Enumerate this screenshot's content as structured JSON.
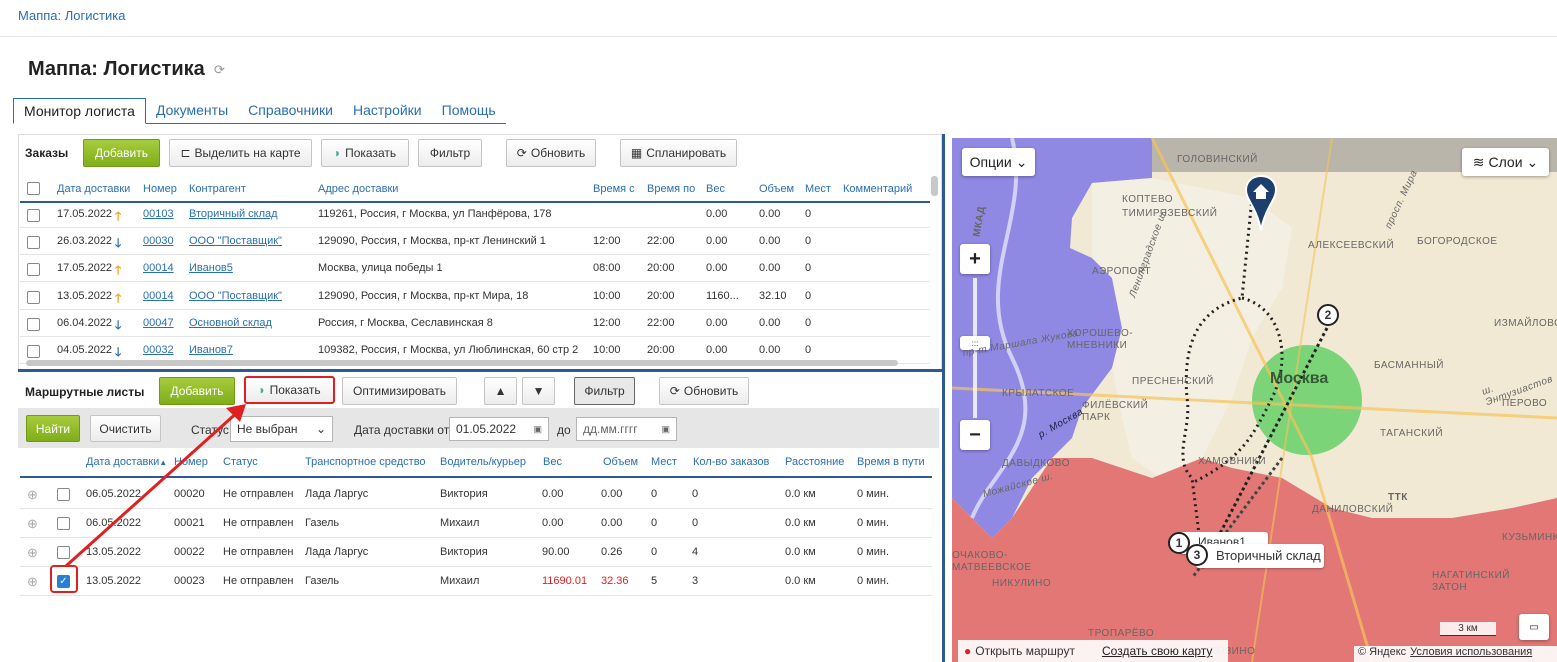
{
  "breadcrumb": "Маппа: Логистика",
  "page_title": "Маппа: Логистика",
  "tabs": [
    "Монитор логиста",
    "Документы",
    "Справочники",
    "Настройки",
    "Помощь"
  ],
  "orders": {
    "label": "Заказы",
    "add": "Добавить",
    "highlight": "Выделить на карте",
    "show": "Показать",
    "filter": "Фильтр",
    "refresh": "Обновить",
    "plan": "Спланировать",
    "headers": [
      "Дата доставки",
      "Номер",
      "Контрагент",
      "Адрес доставки",
      "Время с",
      "Время по",
      "Вес",
      "Объем",
      "Мест",
      "Комментарий"
    ],
    "rows": [
      {
        "date": "17.05.2022",
        "dir": "up",
        "num": "00103",
        "contr": "Вторичный склад",
        "addr": "119261, Россия, г Москва, ул Панфёрова, 178",
        "from": "",
        "to": "",
        "w": "0.00",
        "v": "0.00",
        "p": "0"
      },
      {
        "date": "26.03.2022",
        "dir": "down",
        "num": "00030",
        "contr": "ООО \"Поставщик\"",
        "addr": "129090, Россия, г Москва, пр-кт Ленинский 1",
        "from": "12:00",
        "to": "22:00",
        "w": "0.00",
        "v": "0.00",
        "p": "0"
      },
      {
        "date": "17.05.2022",
        "dir": "up",
        "num": "00014",
        "contr": "Иванов5",
        "addr": "Москва, улица победы 1",
        "from": "08:00",
        "to": "20:00",
        "w": "0.00",
        "v": "0.00",
        "p": "0"
      },
      {
        "date": "13.05.2022",
        "dir": "up",
        "num": "00014",
        "contr": "ООО \"Поставщик\"",
        "addr": "129090, Россия, г Москва, пр-кт Мира, 18",
        "from": "10:00",
        "to": "20:00",
        "w": "1160...",
        "v": "32.10",
        "p": "0"
      },
      {
        "date": "06.04.2022",
        "dir": "down",
        "num": "00047",
        "contr": "Основной склад",
        "addr": "Россия, г Москва, Сеславинская 8",
        "from": "12:00",
        "to": "22:00",
        "w": "0.00",
        "v": "0.00",
        "p": "0"
      },
      {
        "date": "04.05.2022",
        "dir": "down",
        "num": "00032",
        "contr": "Иванов7",
        "addr": "109382, Россия, г Москва, ул Люблинская, 60 стр 2",
        "from": "10:00",
        "to": "20:00",
        "w": "0.00",
        "v": "0.00",
        "p": "0"
      }
    ]
  },
  "routes": {
    "label": "Маршрутные листы",
    "add": "Добавить",
    "show": "Показать",
    "optimize": "Оптимизировать",
    "up": "▲",
    "down": "▼",
    "filter": "Фильтр",
    "refresh": "Обновить",
    "find": "Найти",
    "clear": "Очистить",
    "status_label": "Статус",
    "status_value": "Не выбран",
    "date_from_label": "Дата доставки от",
    "date_from": "01.05.2022",
    "date_to_label": "до",
    "date_to_placeholder": "дд.мм.гггг",
    "headers": [
      "Дата доставки",
      "Номер",
      "Статус",
      "Транспортное средство",
      "Водитель/курьер",
      "Вес",
      "Объем",
      "Мест",
      "Кол-во заказов",
      "Расстояние",
      "Время в пути"
    ],
    "rows": [
      {
        "date": "06.05.2022",
        "num": "00020",
        "status": "Не отправлен",
        "vehicle": "Лада Ларгус",
        "driver": "Виктория",
        "w": "0.00",
        "v": "0.00",
        "p": "0",
        "n": "0",
        "dist": "0.0 км",
        "time": "0 мин.",
        "checked": false,
        "red": false
      },
      {
        "date": "06.05.2022",
        "num": "00021",
        "status": "Не отправлен",
        "vehicle": "Газель",
        "driver": "Михаил",
        "w": "0.00",
        "v": "0.00",
        "p": "0",
        "n": "0",
        "dist": "0.0 км",
        "time": "0 мин.",
        "checked": false,
        "red": false
      },
      {
        "date": "13.05.2022",
        "num": "00022",
        "status": "Не отправлен",
        "vehicle": "Лада Ларгус",
        "driver": "Виктория",
        "w": "90.00",
        "v": "0.26",
        "p": "0",
        "n": "4",
        "dist": "0.0 км",
        "time": "0 мин.",
        "checked": false,
        "red": false
      },
      {
        "date": "13.05.2022",
        "num": "00023",
        "status": "Не отправлен",
        "vehicle": "Газель",
        "driver": "Михаил",
        "w": "11690.01",
        "v": "32.36",
        "p": "5",
        "n": "3",
        "dist": "0.0 км",
        "time": "0 мин.",
        "checked": true,
        "red": true
      }
    ]
  },
  "map": {
    "options": "Опции",
    "layers": "Слои",
    "city": "Москва",
    "zoom_in": "+",
    "zoom_out": "−",
    "labels": [
      "ГОЛОВИНСКИЙ",
      "КОПТЕВО",
      "ТИМИРЯЗЕВСКИЙ",
      "АЭРОПОРТ",
      "АЛЕКСЕЕВСКИЙ",
      "БОГОРОДСКОЕ",
      "ХОРОШЕВО-МНЕВНИКИ",
      "ПРЕСНЕНСКИЙ",
      "КРЫЛАТСКОЕ",
      "ФИЛЁВСКИЙ ПАРК",
      "ДАВЫДКОВО",
      "ХАМОВНИКИ",
      "БАСМАННЫЙ",
      "ТАГАНСКИЙ",
      "ИЗМАЙЛОВО",
      "ПЕРОВО",
      "ДАНИЛОВСКИЙ",
      "НАГАТИНСКИЙ ЗАТОН",
      "ТРОПАРЁВО",
      "НИКУЛИНО",
      "ЗЮЗИНО",
      "ОЧАКОВО-МАТВЕЕВСКОЕ",
      "КУЗЬМИНКИ",
      "ТТК",
      "МКАД"
    ],
    "roads": [
      "Ленинградское ш.",
      "просп. Мира",
      "пр-т Маршала Жукова",
      "р. Москва",
      "Можайское ш.",
      "ш. Энтузиастов"
    ],
    "marker_labels": [
      "Иванов1",
      "Вторичный склад"
    ],
    "marker_nums": [
      "1",
      "2",
      "3"
    ],
    "scale": "3 км",
    "open_route": "Открыть маршрут",
    "create_map": "Создать свою карту",
    "copyright": "© Яндекс",
    "terms": "Условия использования"
  }
}
